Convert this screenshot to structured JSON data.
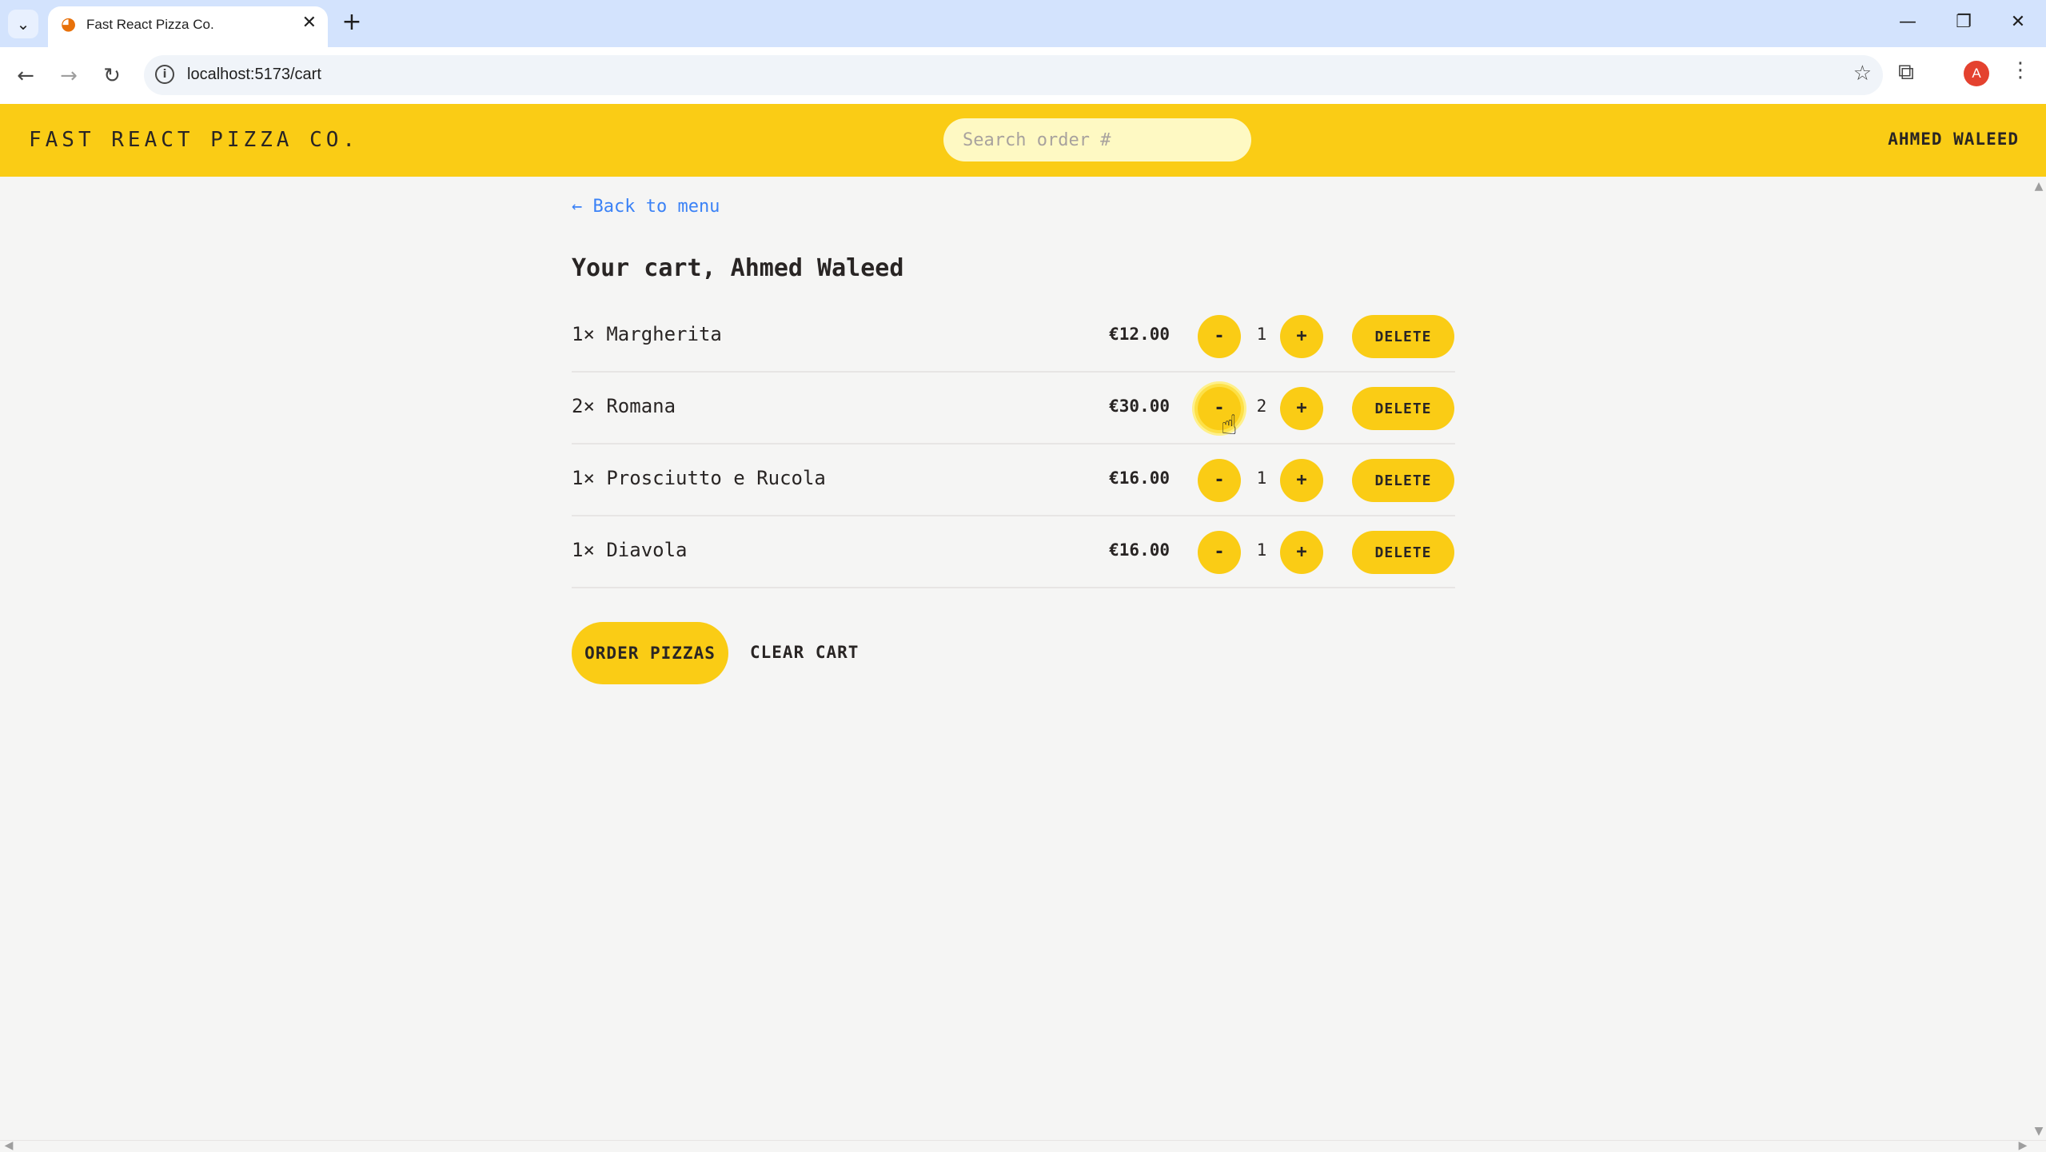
{
  "browser": {
    "tab_title": "Fast React Pizza Co.",
    "favicon": "pizza-icon",
    "close_glyph": "✕",
    "new_tab_glyph": "+",
    "url": "localhost:5173/cart",
    "profile_initial": "A"
  },
  "header": {
    "logo": "Fast React Pizza Co.",
    "search_placeholder": "Search order #",
    "username": "Ahmed Waleed"
  },
  "main": {
    "back_link": "← Back to menu",
    "title": "Your cart, Ahmed Waleed",
    "items": [
      {
        "name": "1× Margherita",
        "price": "€12.00",
        "quantity": "1",
        "minus": "-",
        "plus": "+",
        "delete": "Delete"
      },
      {
        "name": "2× Romana",
        "price": "€30.00",
        "quantity": "2",
        "minus": "-",
        "plus": "+",
        "delete": "Delete"
      },
      {
        "name": "1× Prosciutto e Rucola",
        "price": "€16.00",
        "quantity": "1",
        "minus": "-",
        "plus": "+",
        "delete": "Delete"
      },
      {
        "name": "1× Diavola",
        "price": "€16.00",
        "quantity": "1",
        "minus": "-",
        "plus": "+",
        "delete": "Delete"
      }
    ],
    "order_button": "Order pizzas",
    "clear_button": "Clear cart"
  },
  "colors": {
    "accent": "#facc15",
    "link": "#3b82f6",
    "background": "#f5f5f4"
  }
}
